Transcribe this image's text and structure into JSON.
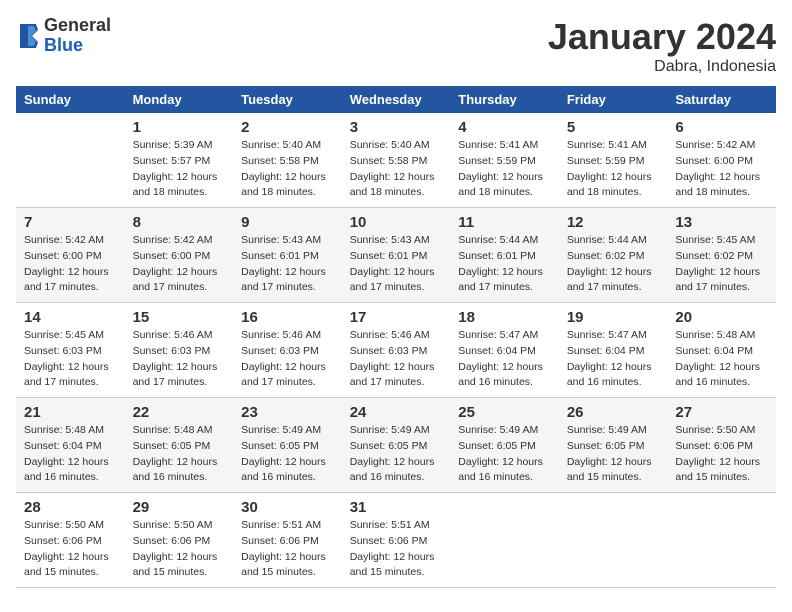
{
  "header": {
    "logo": {
      "general": "General",
      "blue": "Blue"
    },
    "title": "January 2024",
    "subtitle": "Dabra, Indonesia"
  },
  "calendar": {
    "days_of_week": [
      "Sunday",
      "Monday",
      "Tuesday",
      "Wednesday",
      "Thursday",
      "Friday",
      "Saturday"
    ],
    "weeks": [
      [
        {
          "day": "",
          "sunrise": "",
          "sunset": "",
          "daylight": ""
        },
        {
          "day": "1",
          "sunrise": "5:39 AM",
          "sunset": "5:57 PM",
          "daylight": "12 hours and 18 minutes."
        },
        {
          "day": "2",
          "sunrise": "5:40 AM",
          "sunset": "5:58 PM",
          "daylight": "12 hours and 18 minutes."
        },
        {
          "day": "3",
          "sunrise": "5:40 AM",
          "sunset": "5:58 PM",
          "daylight": "12 hours and 18 minutes."
        },
        {
          "day": "4",
          "sunrise": "5:41 AM",
          "sunset": "5:59 PM",
          "daylight": "12 hours and 18 minutes."
        },
        {
          "day": "5",
          "sunrise": "5:41 AM",
          "sunset": "5:59 PM",
          "daylight": "12 hours and 18 minutes."
        },
        {
          "day": "6",
          "sunrise": "5:42 AM",
          "sunset": "6:00 PM",
          "daylight": "12 hours and 18 minutes."
        }
      ],
      [
        {
          "day": "7",
          "sunrise": "5:42 AM",
          "sunset": "6:00 PM",
          "daylight": "12 hours and 17 minutes."
        },
        {
          "day": "8",
          "sunrise": "5:42 AM",
          "sunset": "6:00 PM",
          "daylight": "12 hours and 17 minutes."
        },
        {
          "day": "9",
          "sunrise": "5:43 AM",
          "sunset": "6:01 PM",
          "daylight": "12 hours and 17 minutes."
        },
        {
          "day": "10",
          "sunrise": "5:43 AM",
          "sunset": "6:01 PM",
          "daylight": "12 hours and 17 minutes."
        },
        {
          "day": "11",
          "sunrise": "5:44 AM",
          "sunset": "6:01 PM",
          "daylight": "12 hours and 17 minutes."
        },
        {
          "day": "12",
          "sunrise": "5:44 AM",
          "sunset": "6:02 PM",
          "daylight": "12 hours and 17 minutes."
        },
        {
          "day": "13",
          "sunrise": "5:45 AM",
          "sunset": "6:02 PM",
          "daylight": "12 hours and 17 minutes."
        }
      ],
      [
        {
          "day": "14",
          "sunrise": "5:45 AM",
          "sunset": "6:03 PM",
          "daylight": "12 hours and 17 minutes."
        },
        {
          "day": "15",
          "sunrise": "5:46 AM",
          "sunset": "6:03 PM",
          "daylight": "12 hours and 17 minutes."
        },
        {
          "day": "16",
          "sunrise": "5:46 AM",
          "sunset": "6:03 PM",
          "daylight": "12 hours and 17 minutes."
        },
        {
          "day": "17",
          "sunrise": "5:46 AM",
          "sunset": "6:03 PM",
          "daylight": "12 hours and 17 minutes."
        },
        {
          "day": "18",
          "sunrise": "5:47 AM",
          "sunset": "6:04 PM",
          "daylight": "12 hours and 16 minutes."
        },
        {
          "day": "19",
          "sunrise": "5:47 AM",
          "sunset": "6:04 PM",
          "daylight": "12 hours and 16 minutes."
        },
        {
          "day": "20",
          "sunrise": "5:48 AM",
          "sunset": "6:04 PM",
          "daylight": "12 hours and 16 minutes."
        }
      ],
      [
        {
          "day": "21",
          "sunrise": "5:48 AM",
          "sunset": "6:04 PM",
          "daylight": "12 hours and 16 minutes."
        },
        {
          "day": "22",
          "sunrise": "5:48 AM",
          "sunset": "6:05 PM",
          "daylight": "12 hours and 16 minutes."
        },
        {
          "day": "23",
          "sunrise": "5:49 AM",
          "sunset": "6:05 PM",
          "daylight": "12 hours and 16 minutes."
        },
        {
          "day": "24",
          "sunrise": "5:49 AM",
          "sunset": "6:05 PM",
          "daylight": "12 hours and 16 minutes."
        },
        {
          "day": "25",
          "sunrise": "5:49 AM",
          "sunset": "6:05 PM",
          "daylight": "12 hours and 16 minutes."
        },
        {
          "day": "26",
          "sunrise": "5:49 AM",
          "sunset": "6:05 PM",
          "daylight": "12 hours and 15 minutes."
        },
        {
          "day": "27",
          "sunrise": "5:50 AM",
          "sunset": "6:06 PM",
          "daylight": "12 hours and 15 minutes."
        }
      ],
      [
        {
          "day": "28",
          "sunrise": "5:50 AM",
          "sunset": "6:06 PM",
          "daylight": "12 hours and 15 minutes."
        },
        {
          "day": "29",
          "sunrise": "5:50 AM",
          "sunset": "6:06 PM",
          "daylight": "12 hours and 15 minutes."
        },
        {
          "day": "30",
          "sunrise": "5:51 AM",
          "sunset": "6:06 PM",
          "daylight": "12 hours and 15 minutes."
        },
        {
          "day": "31",
          "sunrise": "5:51 AM",
          "sunset": "6:06 PM",
          "daylight": "12 hours and 15 minutes."
        },
        {
          "day": "",
          "sunrise": "",
          "sunset": "",
          "daylight": ""
        },
        {
          "day": "",
          "sunrise": "",
          "sunset": "",
          "daylight": ""
        },
        {
          "day": "",
          "sunrise": "",
          "sunset": "",
          "daylight": ""
        }
      ]
    ]
  }
}
